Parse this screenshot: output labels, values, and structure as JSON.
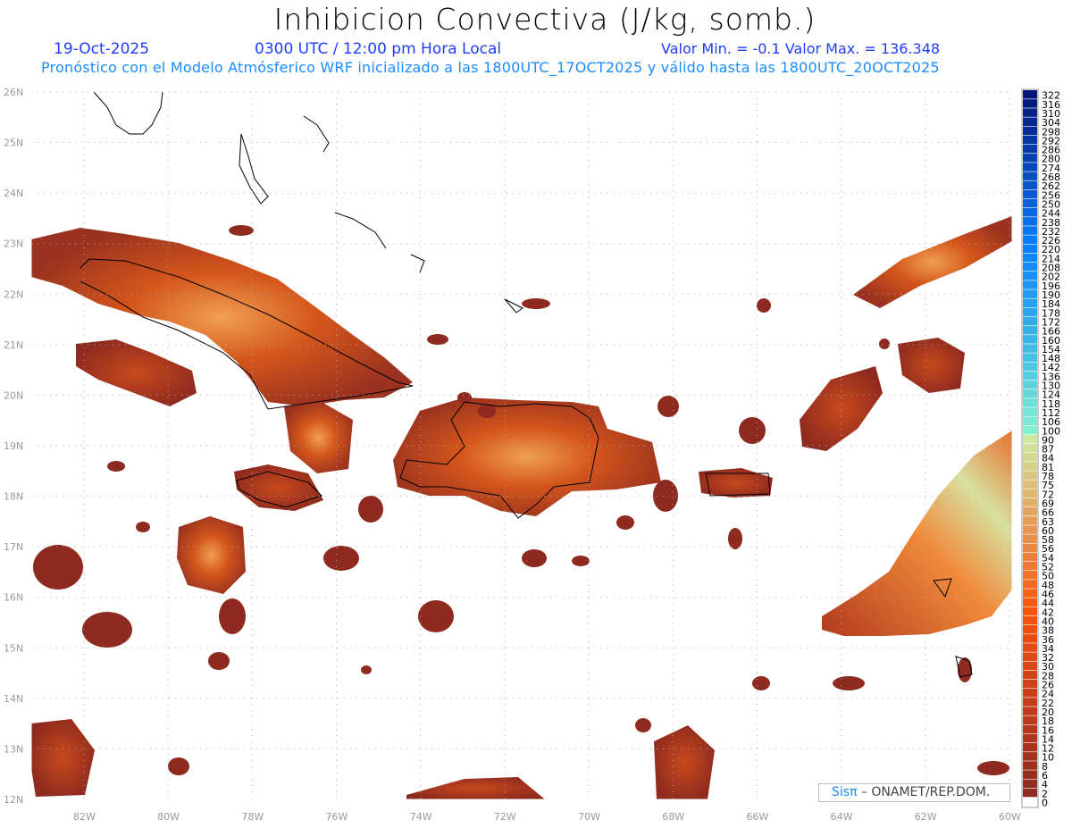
{
  "header": {
    "title": "Inhibicion Convectiva (J/kg, somb.)",
    "date": "19-Oct-2025",
    "time": "0300 UTC / 12:00 pm Hora Local",
    "minmax": "Valor Min. = -0.1  Valor Max. = 136.348",
    "forecast_note": "Pronóstico con el Modelo Atmósferico WRF inicializado a las 1800UTC_17OCT2025 y válido hasta las  1800UTC_20OCT2025"
  },
  "map": {
    "lat_labels": [
      "26N",
      "25N",
      "24N",
      "23N",
      "22N",
      "21N",
      "20N",
      "19N",
      "18N",
      "17N",
      "16N",
      "15N",
      "14N",
      "13N",
      "12N"
    ],
    "lon_labels": [
      "82W",
      "80W",
      "78W",
      "76W",
      "74W",
      "72W",
      "70W",
      "68W",
      "66W",
      "64W",
      "62W",
      "60W"
    ],
    "colors": {
      "low": "#8e2a1f",
      "mid": "#e4561a",
      "high": "#c8eaa0",
      "gridline": "#aaaaaa",
      "coast": "#000000"
    }
  },
  "colorbar": {
    "levels": [
      "322",
      "316",
      "310",
      "304",
      "298",
      "292",
      "286",
      "280",
      "274",
      "268",
      "262",
      "256",
      "250",
      "244",
      "238",
      "232",
      "226",
      "220",
      "214",
      "208",
      "202",
      "196",
      "190",
      "184",
      "178",
      "172",
      "166",
      "160",
      "154",
      "148",
      "142",
      "136",
      "130",
      "124",
      "118",
      "112",
      "106",
      "100",
      "90",
      "87",
      "84",
      "81",
      "78",
      "75",
      "72",
      "69",
      "66",
      "63",
      "60",
      "58",
      "56",
      "54",
      "52",
      "50",
      "48",
      "46",
      "44",
      "42",
      "40",
      "38",
      "36",
      "34",
      "32",
      "30",
      "28",
      "26",
      "24",
      "22",
      "20",
      "18",
      "16",
      "14",
      "12",
      "10",
      "8",
      "6",
      "4",
      "2",
      "0"
    ]
  },
  "credit": {
    "logo": "Sisπ",
    "text": "–  ONAMET/REP.DOM."
  }
}
